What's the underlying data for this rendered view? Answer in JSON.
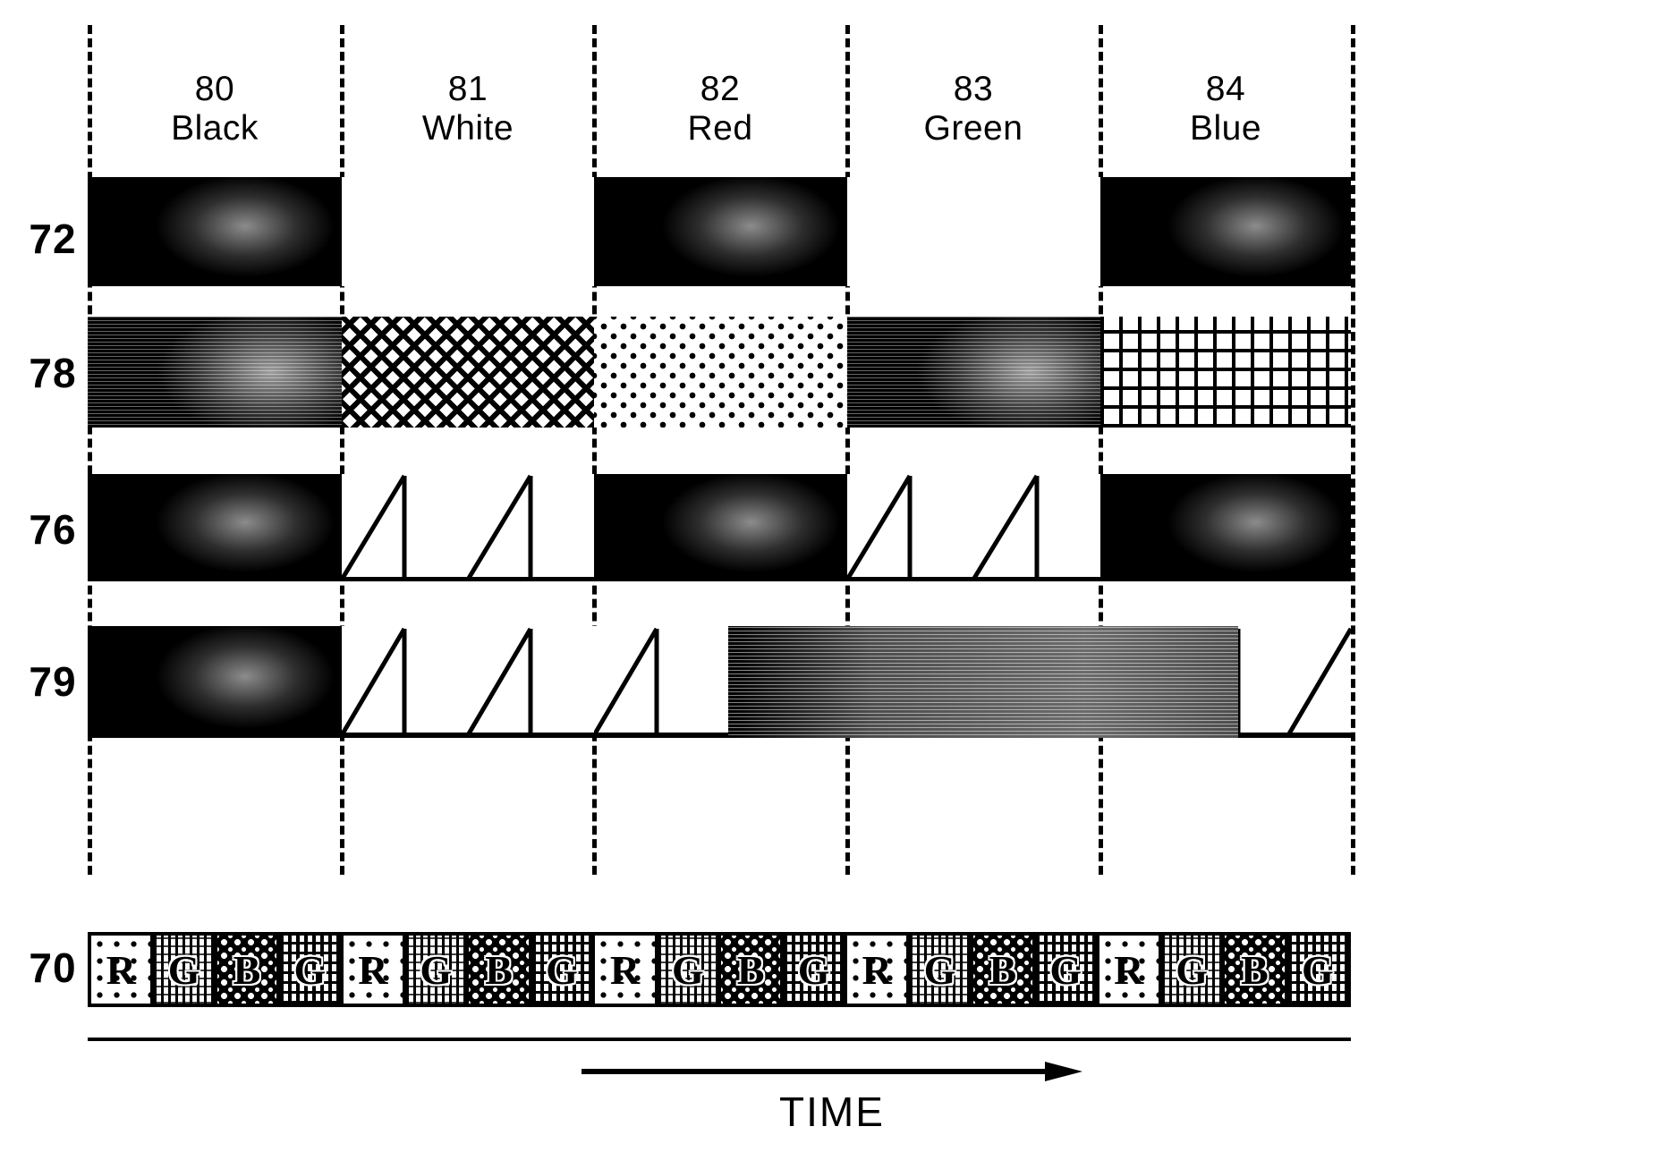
{
  "figure": {
    "time_axis_label": "TIME"
  },
  "columns": [
    {
      "number": "80",
      "name": "Black"
    },
    {
      "number": "81",
      "name": "White"
    },
    {
      "number": "82",
      "name": "Red"
    },
    {
      "number": "83",
      "name": "Green"
    },
    {
      "number": "84",
      "name": "Blue"
    }
  ],
  "rows": [
    {
      "label": "72"
    },
    {
      "label": "78"
    },
    {
      "label": "76"
    },
    {
      "label": "79"
    },
    {
      "label": "70"
    }
  ],
  "subpixels": {
    "sequence": [
      "R",
      "G",
      "B",
      "G"
    ],
    "labels": {
      "red": "R",
      "green": "G",
      "blue": "B"
    }
  },
  "chart_data": {
    "type": "table",
    "title": "",
    "xlabel": "TIME",
    "ylabel": "",
    "grid": true,
    "legend": "none",
    "categories": [
      "80 Black",
      "81 White",
      "82 Red",
      "83 Green",
      "84 Blue"
    ],
    "row_labels": [
      "72",
      "78",
      "76",
      "79",
      "70"
    ],
    "series": [
      {
        "name": "72",
        "values": [
          "black",
          "white",
          "black",
          "white",
          "black"
        ]
      },
      {
        "name": "78",
        "values": [
          "black",
          "crosshatch",
          "dots",
          "black",
          "grid"
        ]
      },
      {
        "name": "76",
        "values": [
          "black",
          "sawtooth",
          "black",
          "sawtooth",
          "black"
        ]
      },
      {
        "name": "79",
        "values": [
          "black",
          "sawtooth",
          "sawtooth-then-black",
          "black-gradient",
          "sawtooth-partial"
        ]
      },
      {
        "name": "70",
        "values": [
          "R G B G",
          "R G B G",
          "R G B G",
          "R G B G",
          "R G B G"
        ]
      }
    ]
  }
}
